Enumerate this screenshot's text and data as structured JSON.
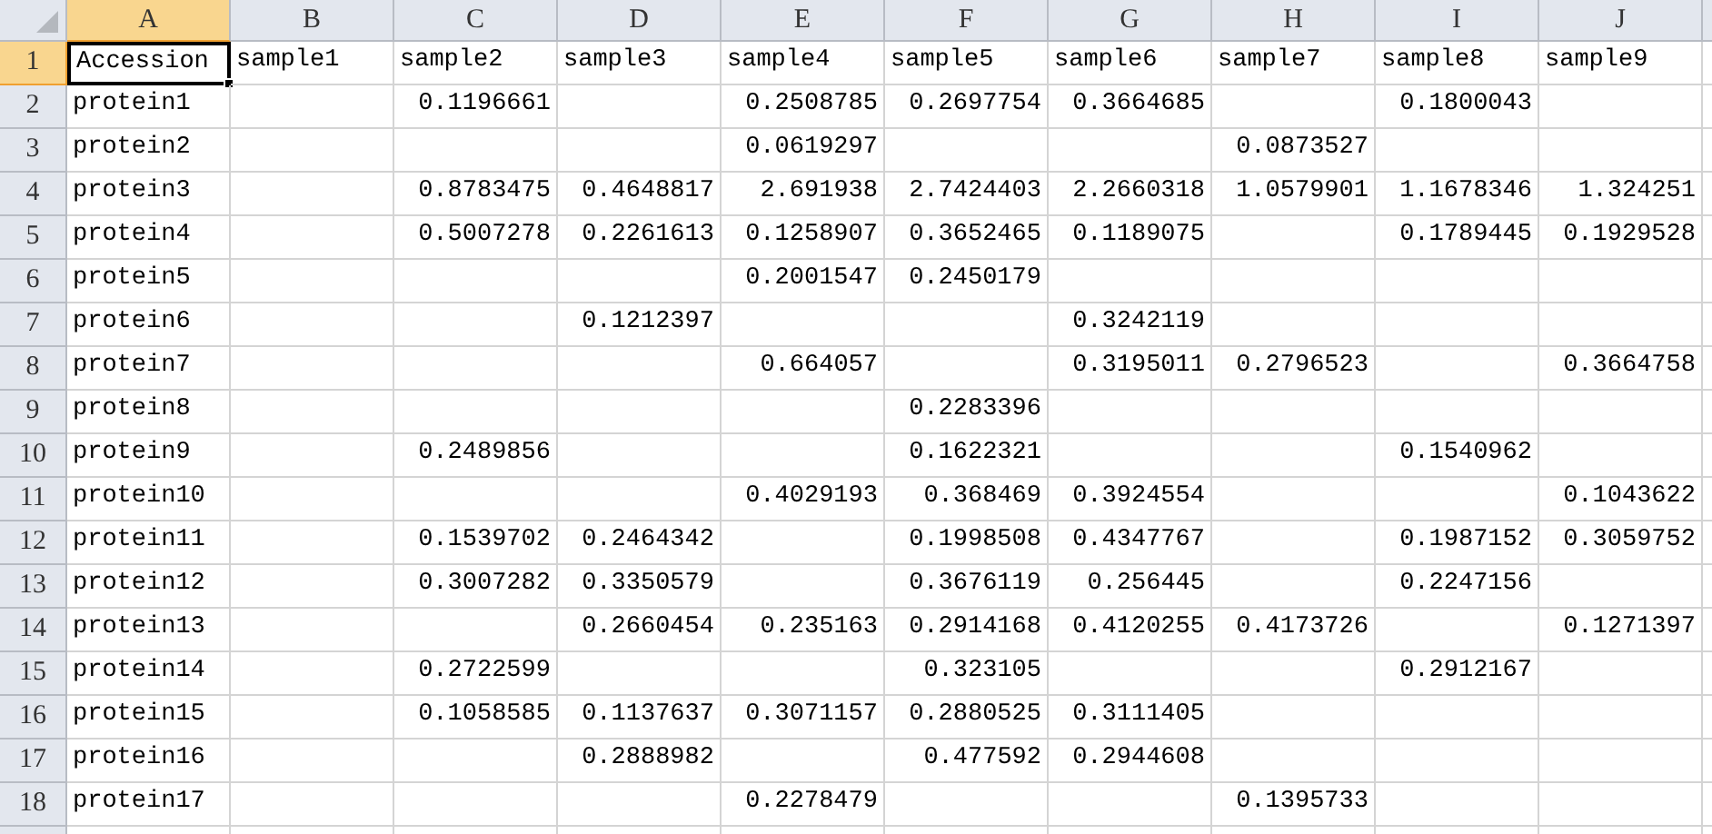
{
  "columns": [
    {
      "label": "A",
      "selected": true
    },
    {
      "label": "B",
      "selected": false
    },
    {
      "label": "C",
      "selected": false
    },
    {
      "label": "D",
      "selected": false
    },
    {
      "label": "E",
      "selected": false
    },
    {
      "label": "F",
      "selected": false
    },
    {
      "label": "G",
      "selected": false
    },
    {
      "label": "H",
      "selected": false
    },
    {
      "label": "I",
      "selected": false
    },
    {
      "label": "J",
      "selected": false
    }
  ],
  "rows": [
    {
      "number": "1",
      "selected": true,
      "cells": [
        "Accession",
        "sample1",
        "sample2",
        "sample3",
        "sample4",
        "sample5",
        "sample6",
        "sample7",
        "sample8",
        "sample9"
      ]
    },
    {
      "number": "2",
      "selected": false,
      "cells": [
        "protein1",
        null,
        "0.1196661",
        null,
        "0.2508785",
        "0.2697754",
        "0.3664685",
        null,
        "0.1800043",
        null
      ]
    },
    {
      "number": "3",
      "selected": false,
      "cells": [
        "protein2",
        null,
        null,
        null,
        "0.0619297",
        null,
        null,
        "0.0873527",
        null,
        null
      ]
    },
    {
      "number": "4",
      "selected": false,
      "cells": [
        "protein3",
        null,
        "0.8783475",
        "0.4648817",
        "2.691938",
        "2.7424403",
        "2.2660318",
        "1.0579901",
        "1.1678346",
        "1.324251"
      ]
    },
    {
      "number": "5",
      "selected": false,
      "cells": [
        "protein4",
        null,
        "0.5007278",
        "0.2261613",
        "0.1258907",
        "0.3652465",
        "0.1189075",
        null,
        "0.1789445",
        "0.1929528"
      ]
    },
    {
      "number": "6",
      "selected": false,
      "cells": [
        "protein5",
        null,
        null,
        null,
        "0.2001547",
        "0.2450179",
        null,
        null,
        null,
        null
      ]
    },
    {
      "number": "7",
      "selected": false,
      "cells": [
        "protein6",
        null,
        null,
        "0.1212397",
        null,
        null,
        "0.3242119",
        null,
        null,
        null
      ]
    },
    {
      "number": "8",
      "selected": false,
      "cells": [
        "protein7",
        null,
        null,
        null,
        "0.664057",
        null,
        "0.3195011",
        "0.2796523",
        null,
        "0.3664758"
      ]
    },
    {
      "number": "9",
      "selected": false,
      "cells": [
        "protein8",
        null,
        null,
        null,
        null,
        "0.2283396",
        null,
        null,
        null,
        null
      ]
    },
    {
      "number": "10",
      "selected": false,
      "cells": [
        "protein9",
        null,
        "0.2489856",
        null,
        null,
        "0.1622321",
        null,
        null,
        "0.1540962",
        null
      ]
    },
    {
      "number": "11",
      "selected": false,
      "cells": [
        "protein10",
        null,
        null,
        null,
        "0.4029193",
        "0.368469",
        "0.3924554",
        null,
        null,
        "0.1043622"
      ]
    },
    {
      "number": "12",
      "selected": false,
      "cells": [
        "protein11",
        null,
        "0.1539702",
        "0.2464342",
        null,
        "0.1998508",
        "0.4347767",
        null,
        "0.1987152",
        "0.3059752"
      ]
    },
    {
      "number": "13",
      "selected": false,
      "cells": [
        "protein12",
        null,
        "0.3007282",
        "0.3350579",
        null,
        "0.3676119",
        "0.256445",
        null,
        "0.2247156",
        null
      ]
    },
    {
      "number": "14",
      "selected": false,
      "cells": [
        "protein13",
        null,
        null,
        "0.2660454",
        "0.235163",
        "0.2914168",
        "0.4120255",
        "0.4173726",
        null,
        "0.1271397"
      ]
    },
    {
      "number": "15",
      "selected": false,
      "cells": [
        "protein14",
        null,
        "0.2722599",
        null,
        null,
        "0.323105",
        null,
        null,
        "0.2912167",
        null
      ]
    },
    {
      "number": "16",
      "selected": false,
      "cells": [
        "protein15",
        null,
        "0.1058585",
        "0.1137637",
        "0.3071157",
        "0.2880525",
        "0.3111405",
        null,
        null,
        null
      ]
    },
    {
      "number": "17",
      "selected": false,
      "cells": [
        "protein16",
        null,
        null,
        "0.2888982",
        null,
        "0.477592",
        "0.2944608",
        null,
        null,
        null
      ]
    },
    {
      "number": "18",
      "selected": false,
      "cells": [
        "protein17",
        null,
        null,
        null,
        "0.2278479",
        null,
        null,
        "0.1395733",
        null,
        null
      ]
    }
  ]
}
